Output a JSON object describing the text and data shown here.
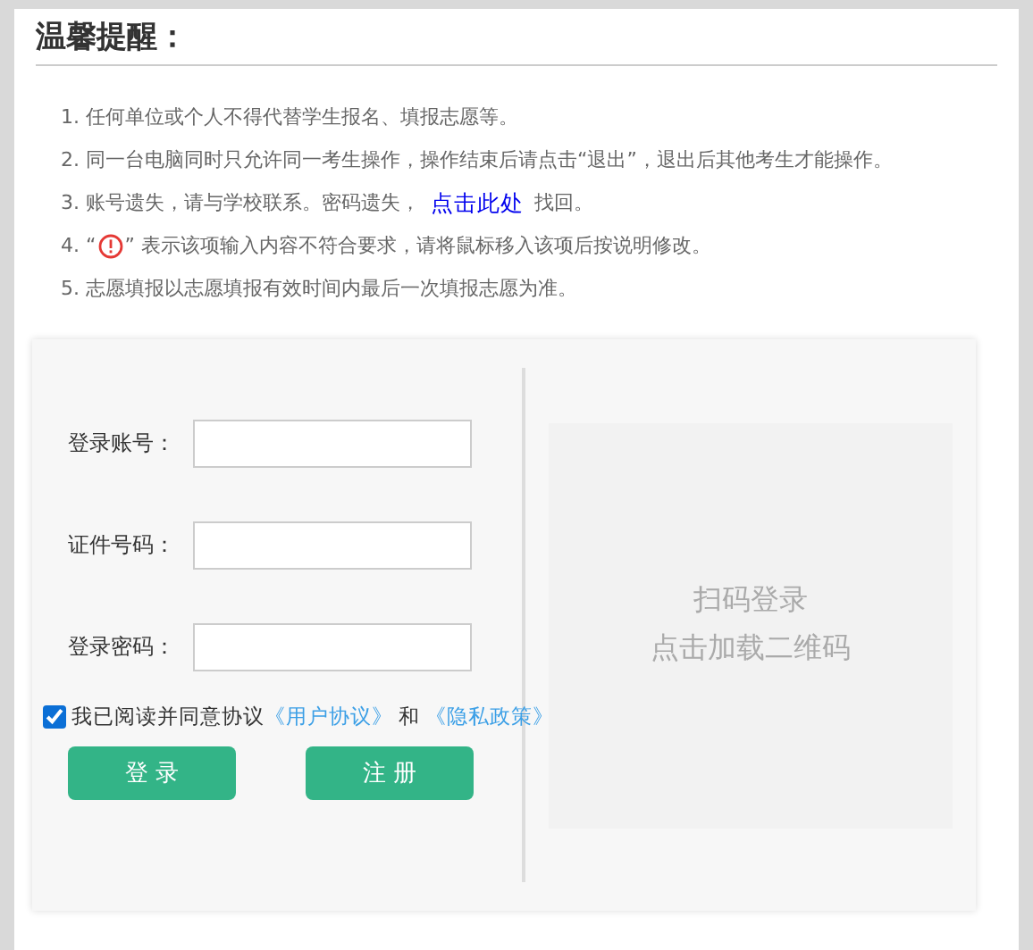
{
  "title": "温馨提醒：",
  "notes": [
    {
      "kind": "text",
      "number": "1.",
      "text": "任何单位或个人不得代替学生报名、填报志愿等。"
    },
    {
      "kind": "text",
      "number": "2.",
      "text": "同一台电脑同时只允许同一考生操作，操作结束后请点击“退出”，退出后其他考生才能操作。"
    },
    {
      "kind": "link",
      "number": "3.",
      "text": "账号遗失，请与学校联系。密码遗失，",
      "link": "点击此处",
      "after": "找回。"
    },
    {
      "kind": "icon",
      "number": "4.",
      "text": "“",
      "after": "” 表示该项输入内容不符合要求，请将鼠标移入该项后按说明修改。"
    },
    {
      "kind": "text",
      "number": "5.",
      "text": "志愿填报以志愿填报有效时间内最后一次填报志愿为准。"
    }
  ],
  "form": {
    "fields": [
      {
        "label": "登录账号："
      },
      {
        "label": "证件号码："
      },
      {
        "label": "登录密码："
      }
    ],
    "agreement": {
      "checked": true,
      "text": "我已阅读并同意协议",
      "user_link": "《用户协议》",
      "and": "和",
      "privacy_link": "《隐私政策》"
    },
    "buttons": [
      "登 录",
      "注 册"
    ]
  },
  "qr": {
    "line_1": "扫码登录",
    "line_2": "点击加载二维码"
  }
}
